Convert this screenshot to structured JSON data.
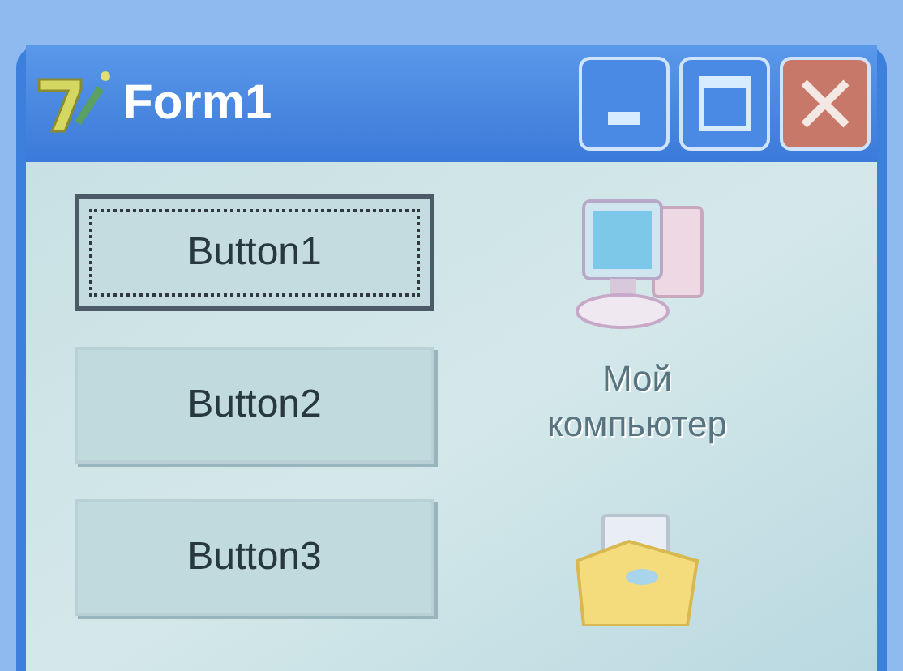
{
  "window": {
    "title": "Form1"
  },
  "buttons": [
    {
      "label": "Button1",
      "focused": true
    },
    {
      "label": "Button2",
      "focused": false
    },
    {
      "label": "Button3",
      "focused": false
    }
  ],
  "desktop_icons": [
    {
      "kind": "computer",
      "label": "Мой компьютер"
    },
    {
      "kind": "folder"
    }
  ]
}
